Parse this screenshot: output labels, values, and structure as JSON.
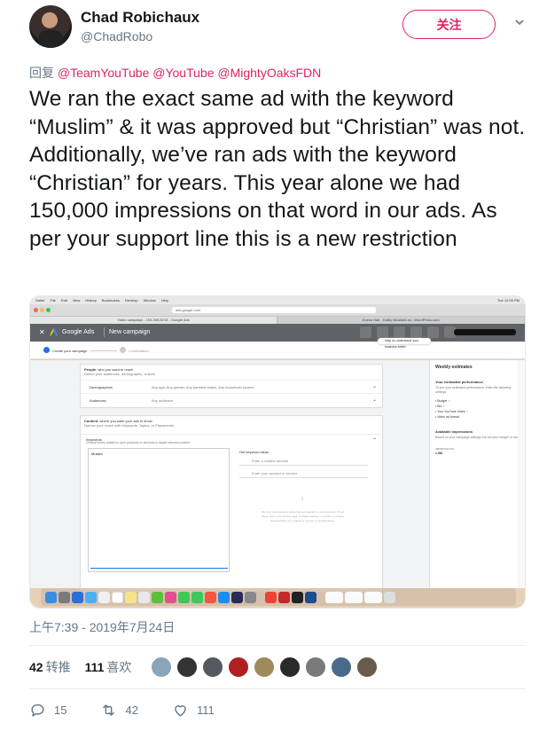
{
  "user": {
    "name": "Chad Robichaux",
    "handle": "@ChadRobo",
    "follow_label": "关注"
  },
  "reply": {
    "prefix": "回复",
    "mentions": [
      "@TeamYouTube",
      "@YouTube",
      "@MightyOaksFDN"
    ]
  },
  "tweet": {
    "text": "We ran the exact same ad with the keyword “Muslim” & it was approved but “Christian” was not. Additionally, we’ve ran ads with the keyword “Christian” for years. This year alone we had 150,000 impressions on that word in our ads. As per your support line this is a new restriction"
  },
  "screenshot": {
    "menubar": [
      "Safari",
      "File",
      "Edit",
      "View",
      "History",
      "Bookmarks",
      "Develop",
      "Window",
      "Help"
    ],
    "menubar_time": "Tue 12:09 PM",
    "address": "ads.google.com",
    "tabs": [
      "Video campaign - 193-399-8215 - Google Ads",
      "Guess Hair - Kathy Nicolaldi-ss - WordPress.com"
    ],
    "app_name": "Google Ads",
    "page_title": "New campaign",
    "help_pill": "Help us understand your business better",
    "steps": [
      "Create your campaign",
      "Confirmation"
    ],
    "people_head_title": "People",
    "people_head_rest": ": who you want to reach",
    "people_sub": "Define your audiences, demographic, or both",
    "rows": [
      {
        "key": "Demographics",
        "value": "Any age, Any gender, Any parental status, Any household income"
      },
      {
        "key": "Audiences",
        "value": "Any audience"
      }
    ],
    "content_head_title": "Content",
    "content_head_rest": ": where you want your ads to show",
    "content_sub": "Narrow your reach with Keywords, Topics, or Placements",
    "keywords_label": "Keywords",
    "keywords_hint": "Choose terms related to your products or services to target relevant content",
    "keyword_value": "Muslim",
    "ideas_title": "Get keyword ideas",
    "ideas_input1": "Enter a related website",
    "ideas_input2": "Enter your product or service",
    "ideas_note": "We only show keyword ideas that are relevant to your business. To get ideas, enter your landing page, a related website, or words or phrases that describe your product or service in the field above",
    "side_title": "Weekly estimates",
    "side_perf_title": "Your estimated performance",
    "side_perf_text": "To see your estimated performance, enter the following settings:",
    "side_items": [
      "Budget",
      "Bid",
      "Your YouTube Video",
      "Video ad format"
    ],
    "side_avail_title": "Available impressions",
    "side_avail_text": "Based on your campaign settings but not your budget or bid",
    "side_avail_label": "IMPRESSIONS",
    "side_avail_value": "1.9M"
  },
  "timestamp": "上午7:39 - 2019年7月24日",
  "stats": {
    "retweets_count": "42",
    "retweets_label": "转推",
    "likes_count": "111",
    "likes_label": "喜欢"
  },
  "actions": {
    "replies": "15",
    "retweets": "42",
    "likes": "111"
  },
  "colors": {
    "accent": "#e0245e",
    "secondary_text": "#657786",
    "primary_text": "#14171a"
  }
}
